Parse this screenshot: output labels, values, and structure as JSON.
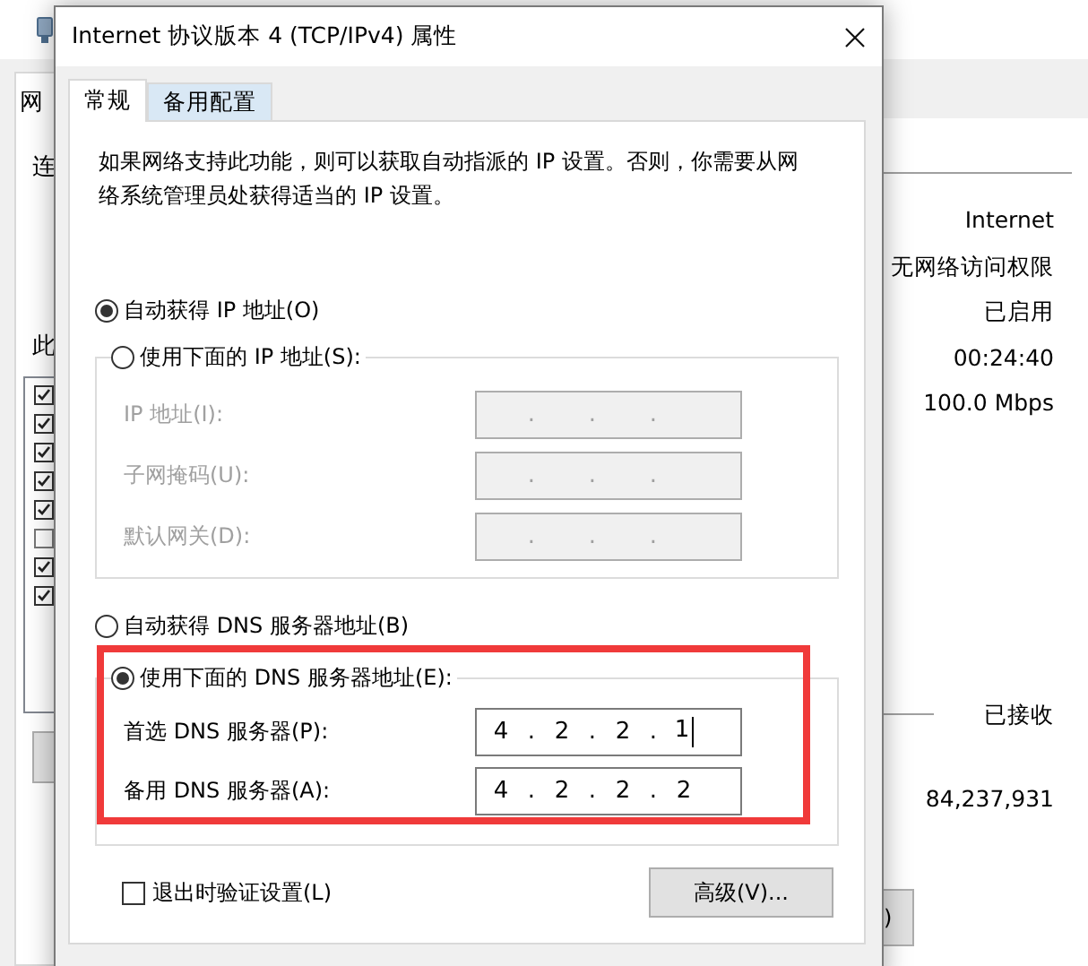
{
  "background_window": {
    "tab": "网",
    "labels": [
      "连",
      "此"
    ],
    "list_checks": [
      true,
      true,
      true,
      true,
      true,
      false,
      true,
      true
    ],
    "values": [
      "Internet",
      "无网络访问权限",
      "已启用",
      "00:24:40",
      "100.0 Mbps"
    ],
    "received_label": "已接收",
    "received_value": "84,237,931",
    "button": ")"
  },
  "dialog": {
    "title": "Internet 协议版本 4 (TCP/IPv4) 属性",
    "tabs": [
      {
        "label": "常规",
        "selected": true
      },
      {
        "label": "备用配置",
        "selected": false
      }
    ],
    "description": "如果网络支持此功能，则可以获取自动指派的 IP 设置。否则，你需要从网络系统管理员处获得适当的 IP 设置。",
    "ip_auto": {
      "label": "自动获得 IP 地址(O)",
      "selected": true
    },
    "ip_manual": {
      "label": "使用下面的 IP 地址(S):",
      "selected": false
    },
    "ip_fields": [
      {
        "label": "IP 地址(I):",
        "disabled": true,
        "separator": "."
      },
      {
        "label": "子网掩码(U):",
        "disabled": true,
        "separator": "."
      },
      {
        "label": "默认网关(D):",
        "disabled": true,
        "separator": "."
      }
    ],
    "dns_auto": {
      "label": "自动获得 DNS 服务器地址(B)",
      "selected": false
    },
    "dns_manual": {
      "label": "使用下面的 DNS 服务器地址(E):",
      "selected": true
    },
    "dns_fields": [
      {
        "label": "首选 DNS 服务器(P):",
        "disabled": false,
        "separator": ".",
        "octets": [
          "4",
          "2",
          "2",
          "1"
        ],
        "focused": true
      },
      {
        "label": "备用 DNS 服务器(A):",
        "disabled": false,
        "separator": ".",
        "octets": [
          "4",
          "2",
          "2",
          "2"
        ],
        "focused": false
      }
    ],
    "validate": {
      "label": "退出时验证设置(L)",
      "checked": false
    },
    "advanced_button": "高级(V)..."
  }
}
